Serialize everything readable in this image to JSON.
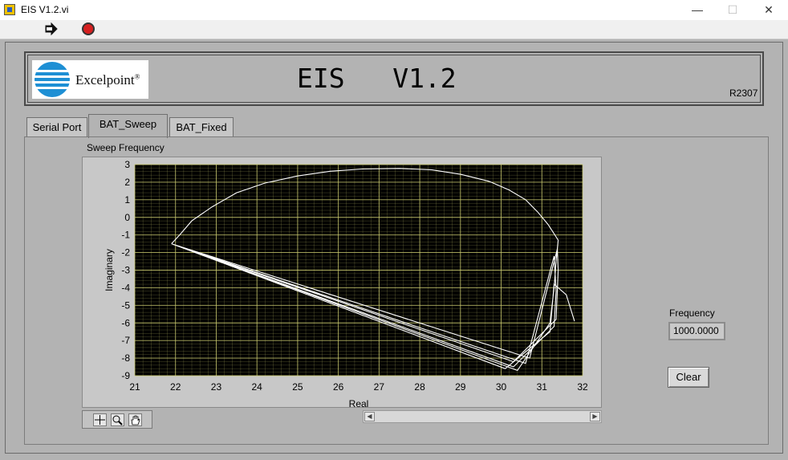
{
  "window": {
    "title": "EIS V1.2.vi",
    "minimize_glyph": "—",
    "maximize_glyph": "☐",
    "close_glyph": "✕"
  },
  "toolbar": {
    "run_icon": "run-arrow-icon",
    "stop_icon": "abort-stop-icon"
  },
  "header": {
    "logo_text": "Excelpoint",
    "logo_reg": "®",
    "title": "EIS   V1.2",
    "revision": "R2307"
  },
  "tabs": [
    {
      "label": "Serial Port"
    },
    {
      "label": "BAT_Sweep"
    },
    {
      "label": "BAT_Fixed"
    }
  ],
  "active_tab": "BAT_Sweep",
  "graph": {
    "label": "Sweep Frequency"
  },
  "frequency": {
    "label": "Frequency",
    "value": "1000.0000"
  },
  "clear_button": {
    "label": "Clear"
  },
  "colors": {
    "plot_bg": "#000000",
    "grid": "#c8c86e",
    "trace": "#ffffff",
    "panel": "#b3b3b3"
  },
  "chart_data": {
    "type": "line",
    "title": "",
    "xlabel": "Real",
    "ylabel": "Imaginary",
    "xlim": [
      21,
      32
    ],
    "ylim": [
      -9,
      3
    ],
    "x_ticks": [
      21,
      22,
      23,
      24,
      25,
      26,
      27,
      28,
      29,
      30,
      31,
      32
    ],
    "y_ticks": [
      3,
      2,
      1,
      0,
      -1,
      -2,
      -3,
      -4,
      -5,
      -6,
      -7,
      -8,
      -9
    ],
    "grid": true,
    "series": [
      {
        "x": [
          21.9,
          22.1,
          22.4,
          22.9,
          23.5,
          24.2,
          25.0,
          25.8,
          26.6,
          27.5,
          28.3,
          29.0,
          29.7,
          30.2,
          30.6,
          30.9,
          31.15,
          31.32,
          31.4,
          31.35,
          31.3,
          31.2,
          30.4,
          21.9,
          30.3,
          31.3,
          31.35,
          31.3,
          30.6,
          21.9,
          30.3,
          31.35,
          31.4,
          31.38,
          30.7,
          21.9,
          30.1,
          31.2,
          31.3,
          31.6,
          31.8
        ],
        "y": [
          -1.5,
          -1.0,
          -0.2,
          0.6,
          1.4,
          1.95,
          2.35,
          2.62,
          2.75,
          2.78,
          2.7,
          2.45,
          2.05,
          1.55,
          1.0,
          0.3,
          -0.4,
          -1.0,
          -1.3,
          -2.5,
          -4.0,
          -6.0,
          -8.7,
          -1.5,
          -8.5,
          -6.2,
          -4.2,
          -2.2,
          -8.3,
          -1.5,
          -8.2,
          -5.8,
          -3.0,
          -1.8,
          -8.0,
          -1.5,
          -8.6,
          -6.5,
          -3.8,
          -4.4,
          -5.9
        ]
      }
    ]
  }
}
